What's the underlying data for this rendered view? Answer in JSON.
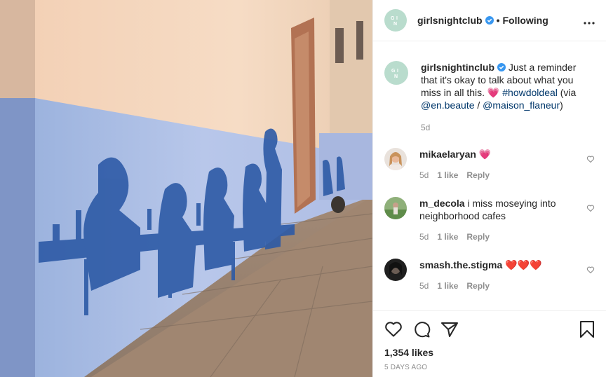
{
  "post": {
    "author": "girlsnightclub",
    "follow_status": "Following",
    "separator": "•",
    "more_icon": "more-horizontal-icon"
  },
  "caption": {
    "author": "girlsnightinclub",
    "text_1": "Just a reminder that it's okay to talk about what you miss in all this.",
    "emoji": "💗",
    "hashtag": "#howdoldeal",
    "text_2": "(via",
    "mention_1": "@en.beaute",
    "slash": "/",
    "mention_2": "@maison_flaneur",
    "text_3": ")",
    "time": "5d"
  },
  "comments": [
    {
      "user": "mikaelaryan",
      "text": "💗",
      "time": "5d",
      "likes": "1 like",
      "reply": "Reply"
    },
    {
      "user": "m_decola",
      "text": "i miss moseying into neighborhood cafes",
      "time": "5d",
      "likes": "1 like",
      "reply": "Reply"
    },
    {
      "user": "smash.the.stigma",
      "text": "❤️❤️❤️",
      "time": "5d",
      "likes": "1 like",
      "reply": "Reply"
    }
  ],
  "footer": {
    "likes": "1,354 likes",
    "posted": "5 DAYS AGO"
  },
  "colors": {
    "brand_avatar": "#b9dccd",
    "link": "#00376b",
    "verified": "#3897f0",
    "muted": "#8e8e8e"
  }
}
